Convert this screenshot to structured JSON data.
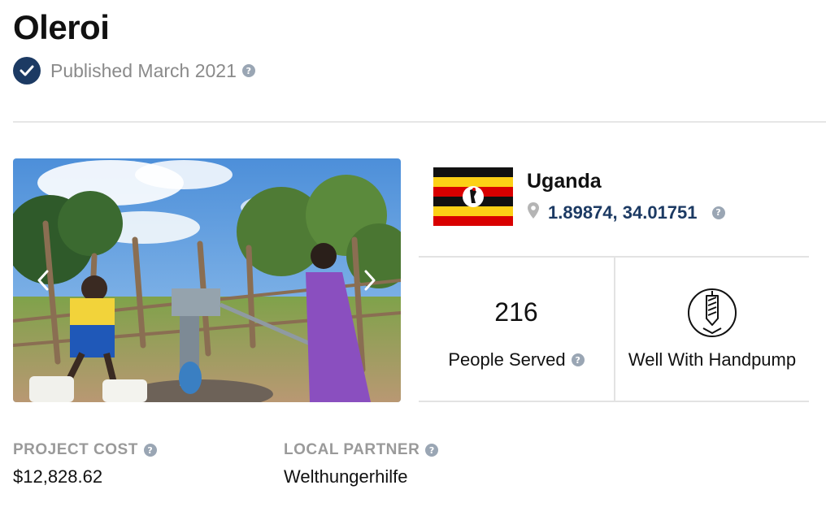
{
  "project": {
    "title": "Oleroi",
    "published": "Published March 2021",
    "help_glyph": "?"
  },
  "location": {
    "country": "Uganda",
    "coordinates": "1.89874, 34.01751",
    "flag": "uganda-flag",
    "pin_icon": "map-pin-icon"
  },
  "stats": {
    "people_served_count": "216",
    "people_served_label": "People Served",
    "water_source_label": "Well With Handpump",
    "water_source_icon": "well-handpump-icon"
  },
  "meta": {
    "cost_label": "PROJECT COST",
    "cost_value": "$12,828.62",
    "partner_label": "LOCAL PARTNER",
    "partner_value": "Welthungerhilfe"
  },
  "gallery": {
    "prev_icon": "chevron-left-icon",
    "next_icon": "chevron-right-icon"
  },
  "colors": {
    "accent_navy": "#1c3a63",
    "muted_text": "#8a8a8a",
    "divider": "#e6e6e6"
  }
}
